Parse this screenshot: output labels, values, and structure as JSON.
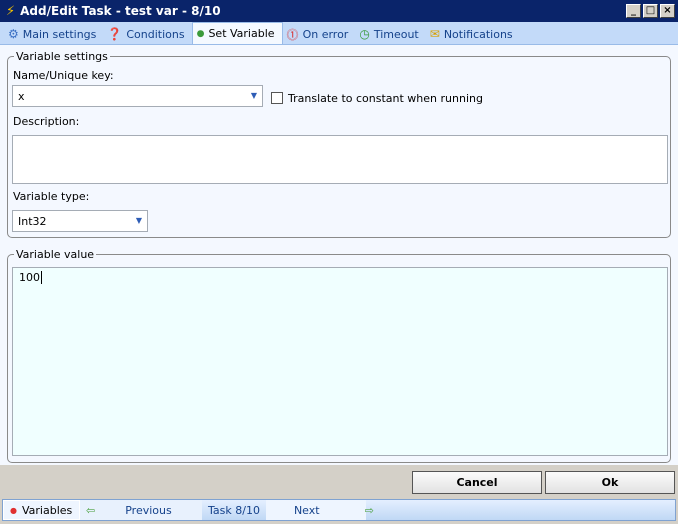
{
  "window": {
    "title": "Add/Edit Task - test var - 8/10"
  },
  "tabs": [
    {
      "label": "Main settings",
      "icon": "gear-icon"
    },
    {
      "label": "Conditions",
      "icon": "question-icon"
    },
    {
      "label": "Set Variable",
      "icon": "dot-icon",
      "active": true
    },
    {
      "label": "On error",
      "icon": "error-icon"
    },
    {
      "label": "Timeout",
      "icon": "clock-icon"
    },
    {
      "label": "Notifications",
      "icon": "envelope-icon"
    }
  ],
  "variable_settings": {
    "legend": "Variable  settings",
    "name_label": "Name/Unique key:",
    "name_value": "x",
    "translate_label": "Translate to constant when running",
    "description_label": "Description:",
    "description_value": "",
    "type_label": "Variable type:",
    "type_value": "Int32"
  },
  "variable_value": {
    "legend": "Variable value",
    "value": "100"
  },
  "buttons": {
    "cancel": "Cancel",
    "ok": "Ok"
  },
  "statusbar": {
    "variables": "Variables",
    "previous": "Previous",
    "task": "Task 8/10",
    "next": "Next"
  }
}
